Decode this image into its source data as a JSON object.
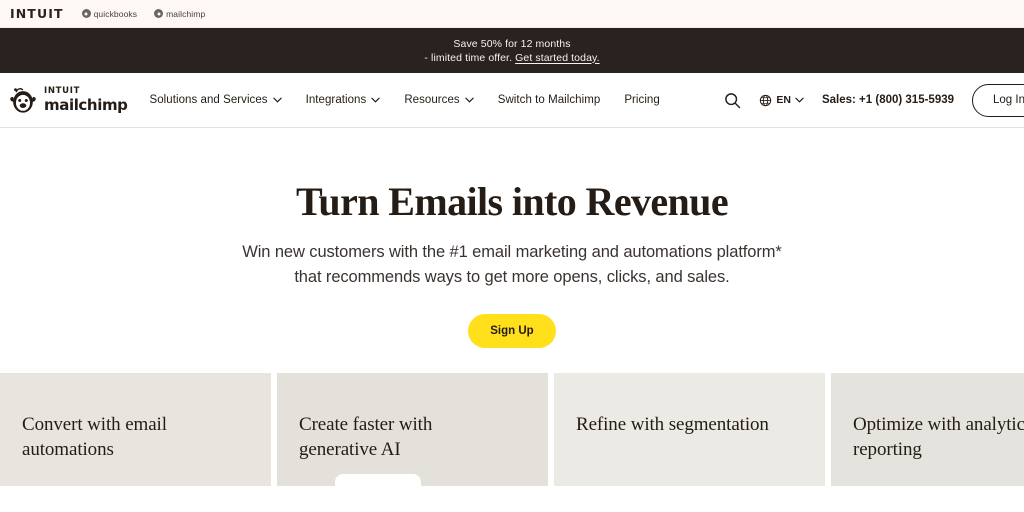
{
  "topbar": {
    "logo": "INTUIT",
    "products": [
      {
        "name": "quickbooks-link",
        "label": "quickbooks"
      },
      {
        "name": "mailchimp-link",
        "label": "mailchimp"
      }
    ]
  },
  "promo": {
    "line1": "Save 50% for 12 months",
    "line2_prefix": "- limited time offer. ",
    "line2_link": "Get started today."
  },
  "nav": {
    "brand_top": "INTUIT",
    "brand_bottom": "mailchimp",
    "links": [
      {
        "label": "Solutions and Services",
        "has_chevron": true
      },
      {
        "label": "Integrations",
        "has_chevron": true
      },
      {
        "label": "Resources",
        "has_chevron": true
      },
      {
        "label": "Switch to Mailchimp",
        "has_chevron": false
      },
      {
        "label": "Pricing",
        "has_chevron": false
      }
    ],
    "search_icon": "search-icon",
    "language": "EN",
    "sales": "Sales: +1 (800) 315-5939",
    "login": "Log In"
  },
  "hero": {
    "title": "Turn Emails into Revenue",
    "subtitle_line1": "Win new customers with the #1 email marketing and automations platform*",
    "subtitle_line2": "that recommends ways to get more opens, clicks, and sales.",
    "cta": "Sign Up"
  },
  "features": [
    {
      "title": "Convert with email automations"
    },
    {
      "title": "Create faster with generative AI"
    },
    {
      "title": "Refine with segmentation"
    },
    {
      "title": "Optimize with analytics and reporting"
    }
  ],
  "colors": {
    "brand_yellow": "#ffe01b",
    "ink": "#241c15",
    "banner_bg": "#2a221e",
    "card_bg": "#e8e5df"
  }
}
